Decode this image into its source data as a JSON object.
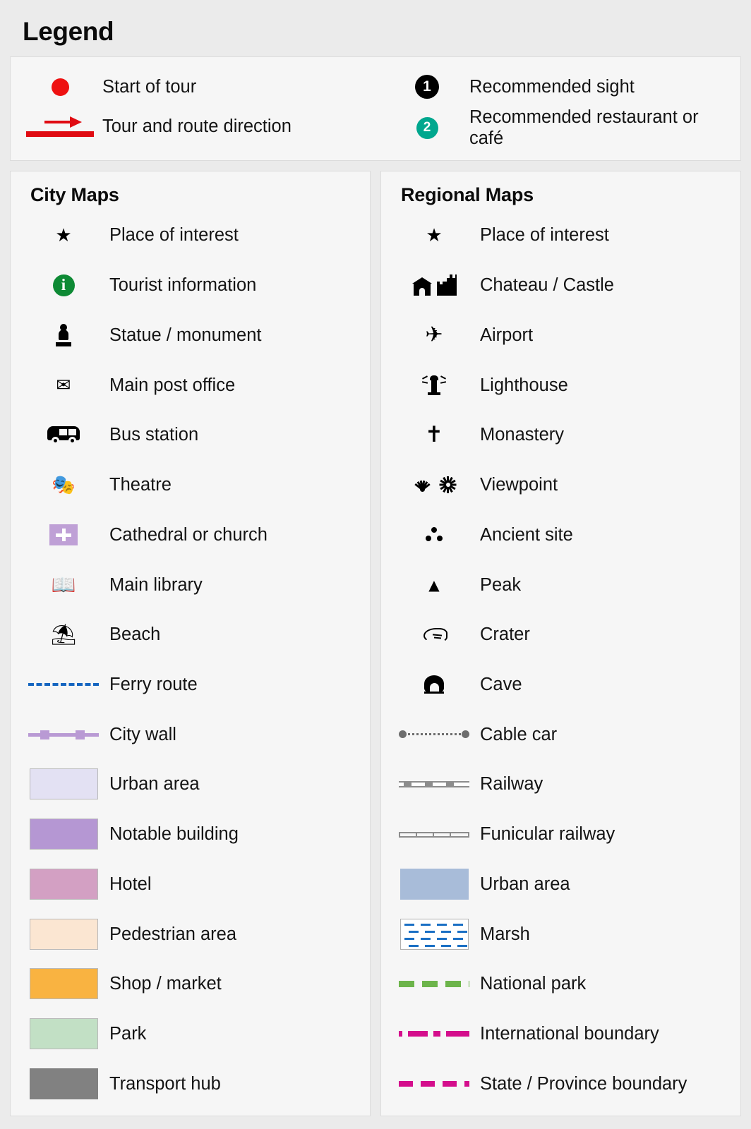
{
  "page": {
    "title": "Legend",
    "background": "#ebebeb",
    "card_background": "#f6f6f6"
  },
  "tour": {
    "items": [
      {
        "icon": "start-of-tour-dot",
        "label": "Start of tour",
        "color": "#ee1111"
      },
      {
        "icon": "tour-direction-arrow",
        "label": "Tour and route direction",
        "color": "#e00b12"
      },
      {
        "icon": "recommended-sight-badge",
        "label": "Recommended sight",
        "badge": "1",
        "color": "#000000"
      },
      {
        "icon": "recommended-restaurant-badge",
        "label": "Recommended restaurant or café",
        "badge": "2",
        "color": "#00a78e"
      }
    ]
  },
  "city_maps": {
    "title": "City Maps",
    "items": [
      {
        "icon": "star-icon",
        "label": "Place of interest",
        "glyph": "★"
      },
      {
        "icon": "tourist-information-icon",
        "label": "Tourist information",
        "glyph": "i",
        "color": "#0e8a35"
      },
      {
        "icon": "statue-monument-icon",
        "label": "Statue / monument"
      },
      {
        "icon": "post-office-icon",
        "label": "Main post office",
        "glyph": "✉"
      },
      {
        "icon": "bus-station-icon",
        "label": "Bus station"
      },
      {
        "icon": "theatre-icon",
        "label": "Theatre",
        "glyph": "🎭"
      },
      {
        "icon": "cathedral-church-icon",
        "label": "Cathedral or church",
        "color": "#bfa0d6"
      },
      {
        "icon": "main-library-icon",
        "label": "Main library",
        "glyph": "📖"
      },
      {
        "icon": "beach-icon",
        "label": "Beach",
        "glyph": "⛱"
      },
      {
        "icon": "ferry-route-line",
        "label": "Ferry route",
        "color": "#1565c0"
      },
      {
        "icon": "city-wall-line",
        "label": "City wall",
        "color": "#b99ad4"
      },
      {
        "icon": "urban-area-swatch",
        "label": "Urban area",
        "color": "#e3e1f3"
      },
      {
        "icon": "notable-building-swatch",
        "label": "Notable building",
        "color": "#b597d3"
      },
      {
        "icon": "hotel-swatch",
        "label": "Hotel",
        "color": "#d3a0c3"
      },
      {
        "icon": "pedestrian-area-swatch",
        "label": "Pedestrian area",
        "color": "#fbe6d2"
      },
      {
        "icon": "shop-market-swatch",
        "label": "Shop / market",
        "color": "#f9b341"
      },
      {
        "icon": "park-swatch",
        "label": "Park",
        "color": "#c2e0c5"
      },
      {
        "icon": "transport-hub-swatch",
        "label": "Transport hub",
        "color": "#818181"
      }
    ]
  },
  "regional_maps": {
    "title": "Regional Maps",
    "items": [
      {
        "icon": "star-icon",
        "label": "Place of interest",
        "glyph": "★"
      },
      {
        "icon": "chateau-castle-icon",
        "label": "Chateau / Castle"
      },
      {
        "icon": "airport-icon",
        "label": "Airport",
        "glyph": "✈"
      },
      {
        "icon": "lighthouse-icon",
        "label": "Lighthouse"
      },
      {
        "icon": "monastery-icon",
        "label": "Monastery",
        "glyph": "✝"
      },
      {
        "icon": "viewpoint-icon",
        "label": "Viewpoint"
      },
      {
        "icon": "ancient-site-icon",
        "label": "Ancient site"
      },
      {
        "icon": "peak-icon",
        "label": "Peak",
        "glyph": "▲"
      },
      {
        "icon": "crater-icon",
        "label": "Crater"
      },
      {
        "icon": "cave-icon",
        "label": "Cave"
      },
      {
        "icon": "cable-car-line",
        "label": "Cable car",
        "color": "#6d6d6d"
      },
      {
        "icon": "railway-line",
        "label": "Railway",
        "color": "#8d8d8d"
      },
      {
        "icon": "funicular-railway-line",
        "label": "Funicular railway",
        "color": "#8d8d8d"
      },
      {
        "icon": "urban-area-swatch",
        "label": "Urban area",
        "color": "#a8bcd9"
      },
      {
        "icon": "marsh-swatch",
        "label": "Marsh",
        "color": "#1a6fc4"
      },
      {
        "icon": "national-park-line",
        "label": "National park",
        "color": "#6cb44a"
      },
      {
        "icon": "international-boundary-line",
        "label": "International boundary",
        "color": "#d40e8c"
      },
      {
        "icon": "state-province-boundary-line",
        "label": "State / Province boundary",
        "color": "#d40e8c"
      }
    ]
  }
}
